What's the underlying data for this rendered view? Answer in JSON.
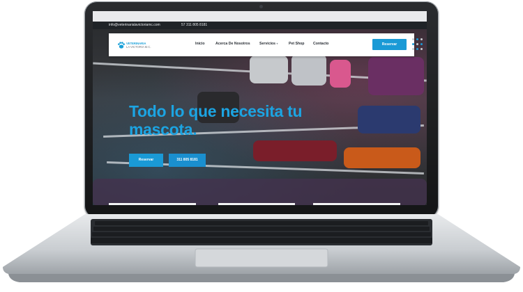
{
  "topbar": {
    "email": "info@veterinarialavictoriamc.com",
    "phone": "57 311 805 8181"
  },
  "logo": {
    "line1": "VETERINARIA",
    "line2": "LA VICTORIA M.C.",
    "icon": "paw-logo-icon"
  },
  "nav": {
    "items": [
      {
        "label": "Inicio"
      },
      {
        "label": "Acerca De Nosotros"
      },
      {
        "label": "Servicios",
        "caret": "▾"
      },
      {
        "label": "Pet Shop"
      },
      {
        "label": "Contacto"
      }
    ],
    "reserve_label": "Reservar",
    "menu_icon": "grid-dots-icon"
  },
  "hero": {
    "headline": "Todo lo que necesita tu mascota.",
    "cta_primary": "Reservar",
    "cta_secondary": "311 805 8181"
  },
  "colors": {
    "brand": "#1a9ad6",
    "headline": "#1ca4e2",
    "topbar": "#1f2327"
  }
}
